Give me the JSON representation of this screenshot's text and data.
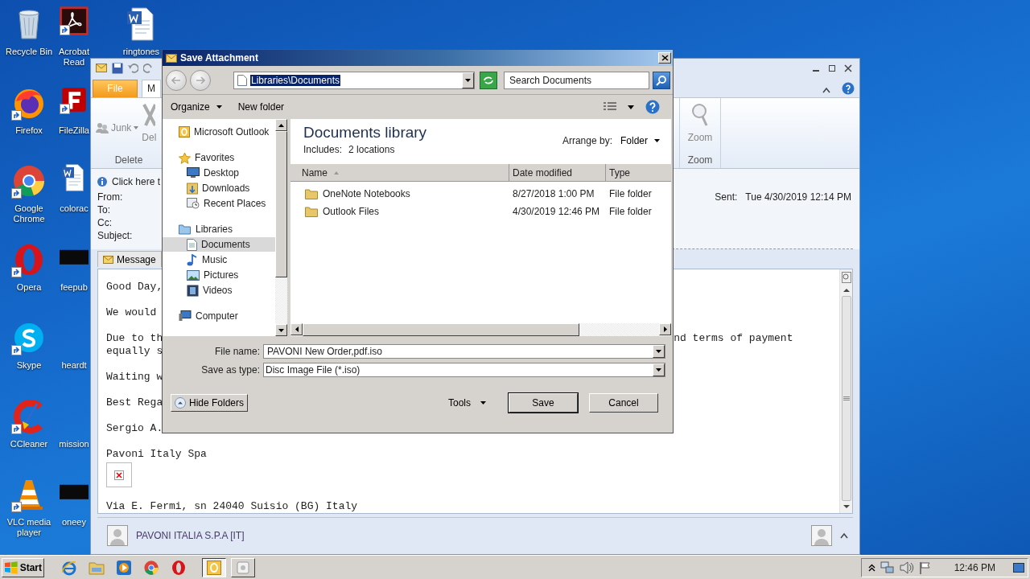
{
  "desktop_icon_columns": [
    {
      "icons": [
        {
          "label": "Recycle Bin",
          "kind": "recycle",
          "shortcut": false
        },
        {
          "label": "Firefox",
          "kind": "firefox",
          "shortcut": true
        },
        {
          "label": "Google Chrome",
          "kind": "chrome",
          "shortcut": true
        },
        {
          "label": "Opera",
          "kind": "opera",
          "shortcut": true
        },
        {
          "label": "Skype",
          "kind": "skype",
          "shortcut": true
        },
        {
          "label": "CCleaner",
          "kind": "ccleaner",
          "shortcut": true
        },
        {
          "label": "VLC media player",
          "kind": "vlc",
          "shortcut": true
        }
      ]
    },
    {
      "icons": [
        {
          "label": "Acrobat Read",
          "kind": "acrobat",
          "shortcut": true
        },
        {
          "label": "FileZilla",
          "kind": "filezilla",
          "shortcut": true
        },
        {
          "label": "colorac",
          "kind": "word",
          "shortcut": false
        },
        {
          "label": "feepub",
          "kind": "thumbnail",
          "shortcut": false
        },
        {
          "label": "heardt",
          "kind": "blank",
          "shortcut": false
        },
        {
          "label": "mission",
          "kind": "blank",
          "shortcut": false
        },
        {
          "label": "oneey",
          "kind": "thumbnail",
          "shortcut": false
        }
      ]
    },
    {
      "icons": [
        {
          "label": "ringtones",
          "kind": "word",
          "shortcut": false
        }
      ]
    }
  ],
  "outlook": {
    "tabs": [
      {
        "label": "File",
        "kind": "file",
        "selected": false
      },
      {
        "label": "M",
        "kind": "normal",
        "selected": true
      }
    ],
    "ribbon": {
      "junk": "Junk",
      "delete": "Del",
      "delete_group": "Delete",
      "zoom": "Zoom",
      "zoom_group": "Zoom"
    },
    "info_bar": "Click here t",
    "fields": [
      "From:",
      "To:",
      "Cc:",
      "Subject:"
    ],
    "sent_label": "Sent:",
    "sent_value": "Tue 4/30/2019 12:14 PM",
    "message_tab": "Message",
    "body": [
      {
        "kind": "text",
        "lines": [
          "Good Day,"
        ]
      },
      {
        "kind": "text",
        "lines": [
          "We would"
        ]
      },
      {
        "kind": "text",
        "lines": [
          "Due to th",
          "equally s"
        ],
        "tail": "nd terms of payment"
      },
      {
        "kind": "text",
        "lines": [
          "Waiting w"
        ]
      },
      {
        "kind": "text",
        "lines": [
          "Best Rega"
        ]
      },
      {
        "kind": "text",
        "lines": [
          "Sergio A."
        ]
      },
      {
        "kind": "text",
        "lines": [
          "Pavoni Italy Spa"
        ]
      },
      {
        "kind": "image"
      },
      {
        "kind": "text",
        "lines": [
          "Via E. Fermi, sn 24040 Suisio (BG) Italy"
        ]
      }
    ],
    "people_pane": {
      "name": "PAVONI ITALIA S.P.A [IT]"
    }
  },
  "dialog": {
    "title": "Save Attachment",
    "address": {
      "value": "Libraries\\Documents",
      "highlighted": true
    },
    "search": {
      "placeholder": "Search Documents"
    },
    "toolbar": {
      "organize": "Organize",
      "new_folder": "New folder"
    },
    "nav": [
      {
        "label": "Microsoft Outlook",
        "kind": "outlook",
        "selected": false
      },
      {
        "label": "Favorites",
        "kind": "star",
        "selected": false,
        "children": [
          {
            "label": "Desktop",
            "kind": "desktop",
            "selected": false
          },
          {
            "label": "Downloads",
            "kind": "downloads",
            "selected": false
          },
          {
            "label": "Recent Places",
            "kind": "recent",
            "selected": false
          }
        ]
      },
      {
        "label": "Libraries",
        "kind": "library",
        "selected": false,
        "children": [
          {
            "label": "Documents",
            "kind": "documents",
            "selected": true
          },
          {
            "label": "Music",
            "kind": "music",
            "selected": false
          },
          {
            "label": "Pictures",
            "kind": "pictures",
            "selected": false
          },
          {
            "label": "Videos",
            "kind": "videos",
            "selected": false
          }
        ]
      },
      {
        "label": "Computer",
        "kind": "computer",
        "selected": false
      }
    ],
    "library_title": "Documents library",
    "includes_label": "Includes:",
    "includes_value": "2 locations",
    "arrange_label": "Arrange by:",
    "arrange_value": "Folder",
    "columns": [
      {
        "label": "Name",
        "sorted": true
      },
      {
        "label": "Date modified",
        "sorted": false
      },
      {
        "label": "Type",
        "sorted": false
      }
    ],
    "files": [
      {
        "name": "OneNote Notebooks",
        "date": "8/27/2018 1:00 PM",
        "type": "File folder",
        "selected": false
      },
      {
        "name": "Outlook Files",
        "date": "4/30/2019 12:46 PM",
        "type": "File folder",
        "selected": false
      }
    ],
    "file_name_label": "File name:",
    "file_name": "PAVONI New Order,pdf.iso",
    "save_type_label": "Save as type:",
    "save_type": "Disc Image File (*.iso)",
    "hide_folders": "Hide Folders",
    "tools": "Tools",
    "save": "Save",
    "cancel": "Cancel"
  },
  "taskbar": {
    "start": "Start",
    "launchers": [
      {
        "kind": "ie"
      },
      {
        "kind": "explorer"
      },
      {
        "kind": "media"
      },
      {
        "kind": "chrome"
      },
      {
        "kind": "opera"
      }
    ],
    "windows": [
      {
        "kind": "outlook",
        "active": true
      },
      {
        "kind": "generic",
        "active": false
      }
    ],
    "clock": "12:46 PM"
  }
}
